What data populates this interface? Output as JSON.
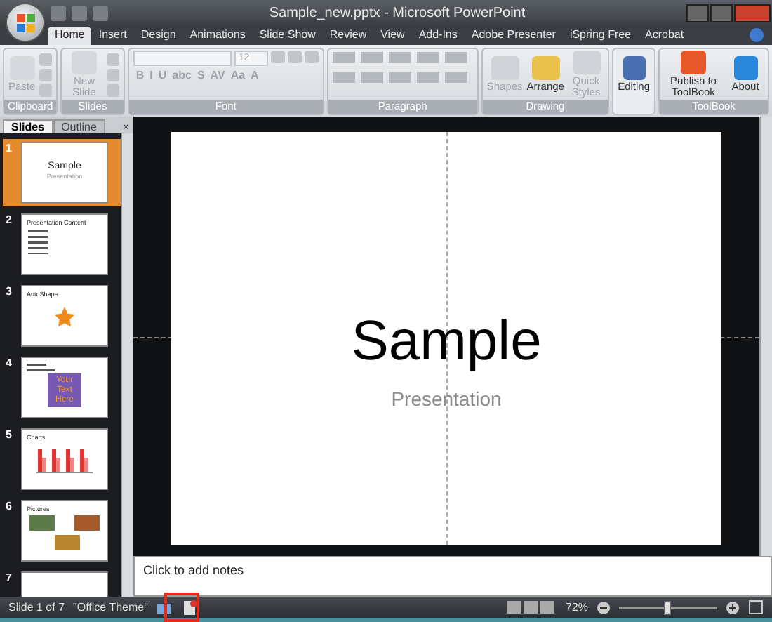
{
  "window": {
    "title": "Sample_new.pptx - Microsoft PowerPoint"
  },
  "tabs": [
    {
      "label": "Home",
      "selected": true
    },
    {
      "label": "Insert",
      "selected": false
    },
    {
      "label": "Design",
      "selected": false
    },
    {
      "label": "Animations",
      "selected": false
    },
    {
      "label": "Slide Show",
      "selected": false
    },
    {
      "label": "Review",
      "selected": false
    },
    {
      "label": "View",
      "selected": false
    },
    {
      "label": "Add-Ins",
      "selected": false
    },
    {
      "label": "Adobe Presenter",
      "selected": false
    },
    {
      "label": "iSpring Free",
      "selected": false
    },
    {
      "label": "Acrobat",
      "selected": false
    }
  ],
  "ribbon": [
    {
      "label": "Clipboard",
      "kind": "clipboard",
      "buttons": [
        {
          "label": "Paste",
          "disabled": true
        }
      ]
    },
    {
      "label": "Slides",
      "kind": "slides",
      "buttons": [
        {
          "label": "New Slide",
          "disabled": true
        }
      ]
    },
    {
      "label": "Font",
      "kind": "font",
      "size": "12",
      "formats": [
        "B",
        "I",
        "U",
        "abc",
        "S",
        "AV",
        "Aa",
        "A"
      ]
    },
    {
      "label": "Paragraph",
      "kind": "paragraph"
    },
    {
      "label": "Drawing",
      "kind": "drawing",
      "buttons": [
        {
          "label": "Shapes",
          "disabled": true
        },
        {
          "label": "Arrange",
          "disabled": false
        },
        {
          "label": "Quick Styles",
          "disabled": true
        }
      ]
    },
    {
      "kind": "editing",
      "buttons": [
        {
          "label": "Editing",
          "disabled": false
        }
      ]
    },
    {
      "label": "ToolBook",
      "kind": "toolbook",
      "buttons": [
        {
          "label": "Publish to ToolBook",
          "disabled": false
        },
        {
          "label": "About",
          "disabled": false
        }
      ]
    }
  ],
  "panel_tabs": [
    {
      "label": "Slides",
      "selected": true
    },
    {
      "label": "Outline",
      "selected": false
    }
  ],
  "panel_close": "×",
  "thumbnails": [
    {
      "number": "1",
      "kind": "title",
      "selected": true,
      "title": "Sample",
      "subtitle": "Presentation"
    },
    {
      "number": "2",
      "kind": "bullets",
      "selected": false,
      "title": "Presentation Content"
    },
    {
      "number": "3",
      "kind": "shape",
      "selected": false,
      "title": "AutoShape"
    },
    {
      "number": "4",
      "kind": "textbox",
      "selected": false,
      "text": "Your Text Here"
    },
    {
      "number": "5",
      "kind": "chart",
      "selected": false,
      "title": "Charts"
    },
    {
      "number": "6",
      "kind": "pictures",
      "selected": false,
      "title": "Pictures"
    },
    {
      "number": "7",
      "kind": "blank",
      "selected": false
    }
  ],
  "slide": {
    "title": "Sample",
    "subtitle": "Presentation"
  },
  "notes": {
    "placeholder": "Click to add notes"
  },
  "status_bar": {
    "slide": "Slide 1 of 7",
    "theme": "\"Office Theme\"",
    "zoom": "72%",
    "level": 0.5
  }
}
